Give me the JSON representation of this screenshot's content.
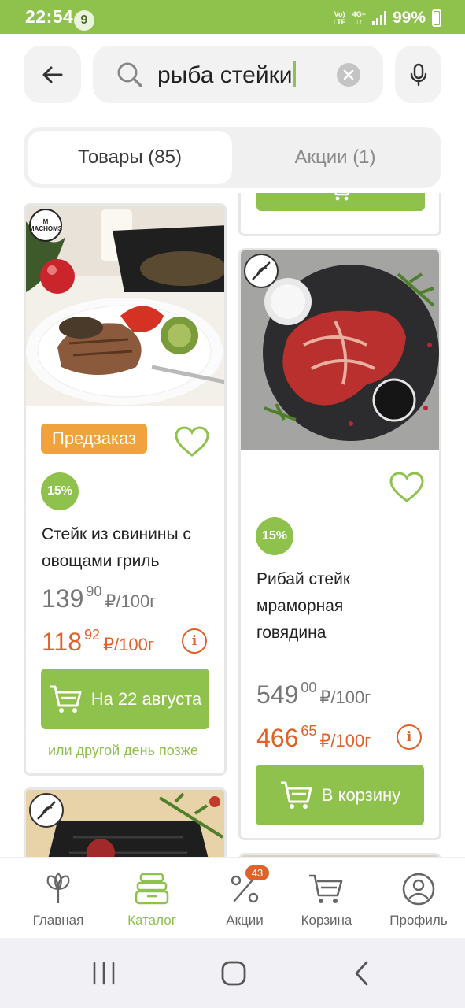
{
  "status_bar": {
    "time": "22:54",
    "notification_count": "9",
    "network_top": "Vo)",
    "network_bottom": "LTE",
    "network_type": "4G+",
    "battery": "99%"
  },
  "search": {
    "query": "рыба стейки",
    "back_icon": "arrow-left-icon",
    "clear_icon": "clear-icon",
    "mic_icon": "microphone-icon"
  },
  "tabs": [
    {
      "label": "Товары (85)",
      "active": true
    },
    {
      "label": "Акции (1)",
      "active": false
    }
  ],
  "products": {
    "left": {
      "preorder_label": "Предзаказ",
      "discount": "15%",
      "name_line1": "Стейк из свинины с",
      "name_line2": "овощами гриль",
      "old_price_int": "139",
      "old_price_dec": "90",
      "new_price_int": "118",
      "new_price_dec": "92",
      "unit": "₽/100г",
      "button_label": "На 22 августа",
      "later_link": "или другой день позже",
      "brand_logo_text": "М MACHOMS"
    },
    "right": {
      "discount": "15%",
      "name_line1": "Рибай стейк",
      "name_line2": "мраморная",
      "name_line3": "говядина",
      "old_price_int": "549",
      "old_price_dec": "00",
      "new_price_int": "466",
      "new_price_dec": "65",
      "unit": "₽/100г",
      "button_label": "В корзину"
    }
  },
  "bottom_nav": [
    {
      "label": "Главная",
      "icon": "home-flower-icon"
    },
    {
      "label": "Каталог",
      "icon": "catalog-icon",
      "active": true
    },
    {
      "label": "Акции",
      "icon": "promo-icon",
      "badge": "43"
    },
    {
      "label": "Корзина",
      "icon": "cart-icon"
    },
    {
      "label": "Профиль",
      "icon": "profile-icon"
    }
  ],
  "colors": {
    "brand_green": "#8fc14d",
    "price_orange": "#e0622a",
    "preorder_orange": "#f0a23d"
  }
}
